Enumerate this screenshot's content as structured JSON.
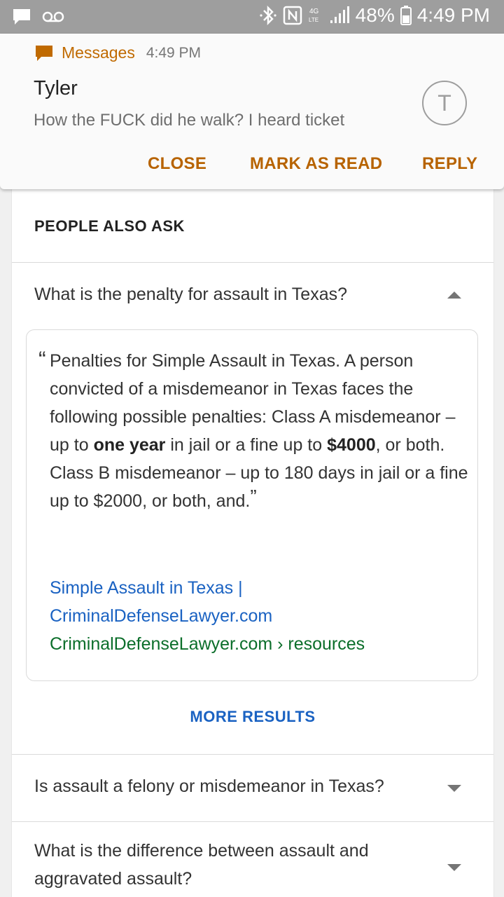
{
  "status_bar": {
    "icons": [
      "message-icon",
      "voicemail-icon",
      "bluetooth-icon",
      "nfc-icon",
      "4g-lte-icon",
      "signal-icon"
    ],
    "battery": "48%",
    "time": "4:49 PM"
  },
  "notification": {
    "app_name": "Messages",
    "time": "4:49 PM",
    "sender": "Tyler",
    "message": "How the FUCK did he walk? I heard ticket",
    "avatar_letter": "T",
    "actions": {
      "close": "CLOSE",
      "mark_as_read": "MARK AS READ",
      "reply": "REPLY"
    },
    "accent_color": "#c06a00"
  },
  "people_also_ask": {
    "title": "PEOPLE ALSO ASK",
    "questions": [
      {
        "text": "What is the penalty for assault in Texas?",
        "expanded": true
      },
      {
        "text": "Is assault a felony or misdemeanor in Texas?",
        "expanded": false
      },
      {
        "text": "What is the difference between assault and aggravated assault?",
        "expanded": false
      }
    ],
    "answer": {
      "open_quote": "“",
      "segments": [
        "Penalties for Simple Assault in Texas. A person convicted of a misdemeanor in Texas faces the following possible penalties: Class A misdemeanor – up to ",
        "one year",
        " in jail or a fine up to ",
        "$4000",
        ", or both. Class B misdemeanor – up to 180 days in jail or a fine up to $2000, or both, and."
      ],
      "close_quote": "”",
      "source_title": "Simple Assault in Texas | CriminalDefenseLawyer.com",
      "source_url": "CriminalDefenseLawyer.com › resources"
    },
    "more_results": "MORE RESULTS",
    "link_color": "#1a62c2",
    "url_color": "#0b6e2a"
  }
}
